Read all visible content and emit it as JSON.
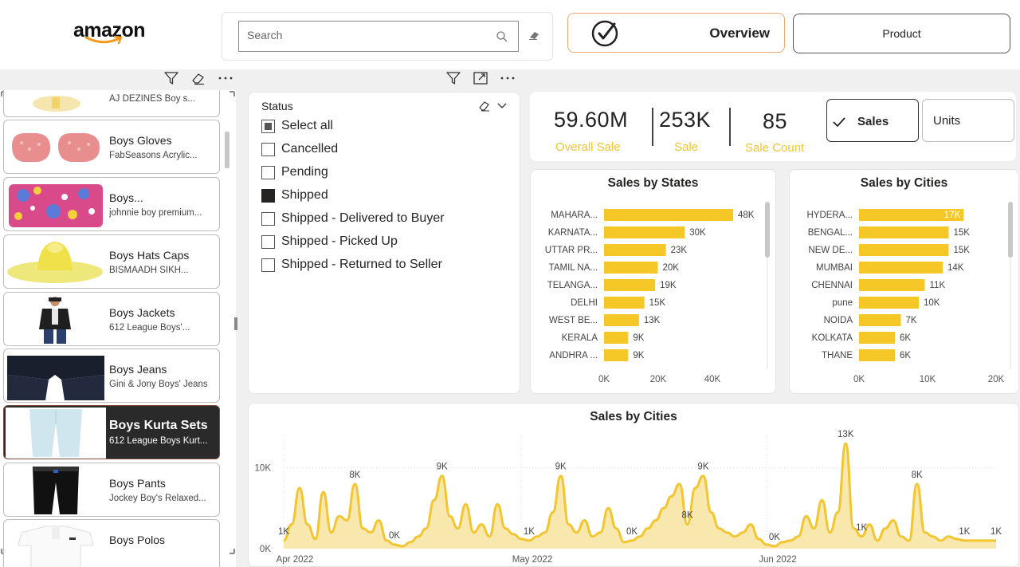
{
  "header": {
    "logo_text": "amazon",
    "search": {
      "placeholder": "Search"
    },
    "nav": {
      "overview_label": "Overview",
      "product_label": "Product"
    }
  },
  "products": [
    {
      "name": "",
      "desc": "AJ DEZINES Boy s...",
      "thumb": "yellow-partial"
    },
    {
      "name": "Boys Gloves",
      "desc": "FabSeasons Acrylic...",
      "thumb": "pink-gloves"
    },
    {
      "name": "Boys...",
      "desc": "johnnie boy premium...",
      "thumb": "floral-towel"
    },
    {
      "name": "Boys Hats Caps",
      "desc": "BISMAADH SIKH...",
      "thumb": "yellow-hat"
    },
    {
      "name": "Boys Jackets",
      "desc": "612 League Boys'...",
      "thumb": "boy-jacket"
    },
    {
      "name": "Boys Jeans",
      "desc": "Gini & Jony Boys' Jeans",
      "thumb": "dark-jeans"
    },
    {
      "name": "Boys Kurta Sets",
      "desc": "612 League Boys Kurt...",
      "thumb": "light-pants",
      "selected": true
    },
    {
      "name": "Boys Pants",
      "desc": "Jockey Boy's Relaxed...",
      "thumb": "black-pants"
    },
    {
      "name": "Boys Polos",
      "desc": "",
      "thumb": "white-polo"
    }
  ],
  "status": {
    "title": "Status",
    "items": [
      {
        "label": "Select all",
        "state": "partial"
      },
      {
        "label": "Cancelled",
        "state": "unchecked"
      },
      {
        "label": "Pending",
        "state": "unchecked"
      },
      {
        "label": "Shipped",
        "state": "checked"
      },
      {
        "label": "Shipped - Delivered to Buyer",
        "state": "unchecked"
      },
      {
        "label": "Shipped - Picked Up",
        "state": "unchecked"
      },
      {
        "label": "Shipped - Returned to Seller",
        "state": "unchecked"
      }
    ]
  },
  "kpis": {
    "overall_sale": {
      "value": "59.60M",
      "label": "Overall Sale"
    },
    "sale": {
      "value": "253K",
      "label": "Sale"
    },
    "sale_count": {
      "value": "85",
      "label": "Sale Count"
    }
  },
  "toggle": {
    "sales_label": "Sales",
    "units_label": "Units",
    "selected": "Sales"
  },
  "colors": {
    "bar": "#f5c827",
    "kpi_label": "#f2c531",
    "area_fill": "#f8e4a0",
    "line": "#f2c531"
  },
  "chart_data": [
    {
      "type": "bar",
      "orientation": "horizontal",
      "title": "Sales by States",
      "categories": [
        "MAHARA...",
        "KARNATA...",
        "UTTAR PR...",
        "TAMIL NA...",
        "TELANGA...",
        "DELHI",
        "WEST BE...",
        "KERALA",
        "ANDHRA ..."
      ],
      "values": [
        48000,
        30000,
        23000,
        20000,
        19000,
        15000,
        13000,
        9000,
        9000
      ],
      "data_labels": [
        "48K",
        "30K",
        "23K",
        "20K",
        "19K",
        "15K",
        "13K",
        "9K",
        "9K"
      ],
      "xticks": [
        "0K",
        "20K",
        "40K"
      ],
      "xlim": [
        0,
        48000
      ]
    },
    {
      "type": "bar",
      "orientation": "horizontal",
      "title": "Sales by Cities",
      "categories": [
        "HYDERA...",
        "BENGAL...",
        "NEW DE...",
        "MUMBAI",
        "CHENNAI",
        "pune",
        "NOIDA",
        "KOLKATA",
        "THANE"
      ],
      "values": [
        17500,
        15000,
        15000,
        14000,
        11000,
        10000,
        7000,
        6000,
        6000
      ],
      "data_labels": [
        "17K",
        "15K",
        "15K",
        "14K",
        "11K",
        "10K",
        "7K",
        "6K",
        "6K"
      ],
      "xticks": [
        "0K",
        "10K",
        "20K"
      ],
      "xlim": [
        0,
        20000
      ]
    },
    {
      "type": "area",
      "title": "Sales by Cities",
      "x": [
        0,
        1,
        2,
        3,
        4,
        5,
        6,
        7,
        8,
        9,
        10,
        11,
        12,
        13,
        14,
        15,
        16,
        17,
        18,
        19,
        20,
        21,
        22,
        23,
        24,
        25,
        26,
        27,
        28,
        29,
        30,
        31,
        32,
        33,
        34,
        35,
        36,
        37,
        38,
        39,
        40,
        41,
        42,
        43,
        44,
        45,
        46,
        47,
        48,
        49,
        50,
        51,
        52,
        53,
        54,
        55,
        56,
        57,
        58,
        59,
        60,
        61,
        62,
        63,
        64,
        65,
        66,
        67,
        68,
        69,
        70,
        71,
        72,
        73,
        74,
        75,
        76,
        77,
        78,
        79,
        80,
        81,
        82,
        83,
        84,
        85,
        86,
        87,
        88,
        89,
        90
      ],
      "values": [
        1000,
        3000,
        7500,
        3000,
        1200,
        7000,
        2000,
        4000,
        3500,
        8000,
        2500,
        2000,
        3500,
        1000,
        500,
        300,
        800,
        1500,
        2500,
        6000,
        9000,
        4000,
        2500,
        5500,
        2000,
        3000,
        1500,
        5500,
        2500,
        1800,
        1200,
        1000,
        1500,
        2000,
        4500,
        9000,
        3000,
        2000,
        3500,
        1500,
        2000,
        5000,
        2500,
        800,
        1000,
        1500,
        2500,
        3500,
        5000,
        6500,
        8000,
        3000,
        7500,
        9000,
        4500,
        2500,
        2000,
        1500,
        2000,
        3000,
        1200,
        500,
        300,
        800,
        1000,
        1500,
        4000,
        2500,
        6000,
        2000,
        4500,
        13000,
        2500,
        1500,
        3000,
        1000,
        2500,
        3500,
        1500,
        1000,
        8000,
        2000,
        1500,
        1000,
        1500,
        1200,
        1000,
        1000,
        1000,
        1000,
        1000
      ],
      "point_labels": [
        {
          "i": 0,
          "text": "1K"
        },
        {
          "i": 9,
          "text": "8K"
        },
        {
          "i": 14,
          "text": "0K"
        },
        {
          "i": 20,
          "text": "9K"
        },
        {
          "i": 31,
          "text": "1K"
        },
        {
          "i": 35,
          "text": "9K"
        },
        {
          "i": 44,
          "text": "0K"
        },
        {
          "i": 51,
          "text": "8K"
        },
        {
          "i": 53,
          "text": "9K"
        },
        {
          "i": 62,
          "text": "0K"
        },
        {
          "i": 71,
          "text": "13K"
        },
        {
          "i": 73,
          "text": "1K"
        },
        {
          "i": 80,
          "text": "8K"
        },
        {
          "i": 86,
          "text": "1K"
        },
        {
          "i": 90,
          "text": "1K"
        }
      ],
      "yticks": [
        "0K",
        "10K"
      ],
      "ylim": [
        0,
        14000
      ],
      "xticks": [
        "Apr 2022",
        "May 2022",
        "Jun 2022"
      ],
      "xtick_index": [
        0,
        30,
        61
      ]
    }
  ]
}
